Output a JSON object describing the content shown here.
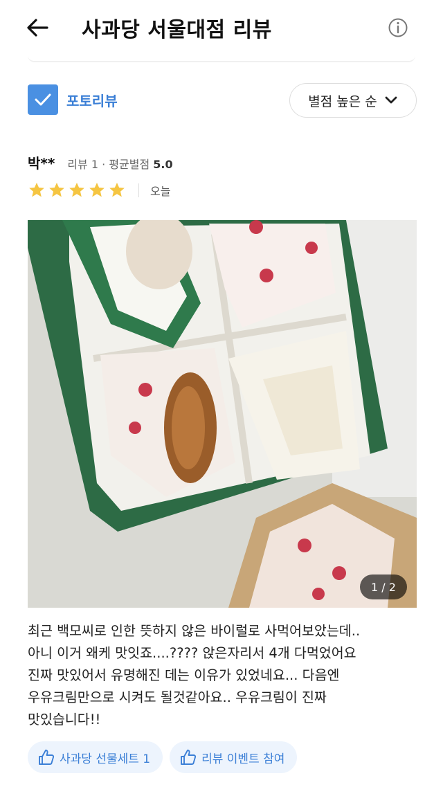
{
  "header": {
    "title": "사과당 서울대점 리뷰",
    "back_icon": "back-arrow-icon",
    "info_icon": "info-icon"
  },
  "filter": {
    "photo_review_label": "포토리뷰",
    "photo_review_checked": true,
    "sort_label": "별점 높은 순",
    "accent_color": "#4a90e2"
  },
  "review": {
    "user_name": "박**",
    "review_count_label": "리뷰 1",
    "avg_rating_label": "평균별점",
    "avg_rating_value": "5.0",
    "rating": 5,
    "rating_max": 5,
    "star_color": "#f5c542",
    "date": "오늘",
    "photo_counter": "1 / 2",
    "text": "최근 백모씨로 인한 뜻하지 않은 바이럴로 사먹어보았는데..\n아니 이거 왜케 맛잇죠....???? 앉은자리서 4개 다먹었어요\n진짜 맛있어서 유명해진 데는 이유가 있었네요... 다음엔\n우유크림만으로 시켜도 될것같아요.. 우유크림이 진짜\n맛있습니다!!",
    "tags": [
      {
        "label": "사과당 선물세트 1",
        "icon": "thumbs-up-icon"
      },
      {
        "label": "리뷰 이벤트 참여",
        "icon": "thumbs-up-icon"
      }
    ]
  }
}
